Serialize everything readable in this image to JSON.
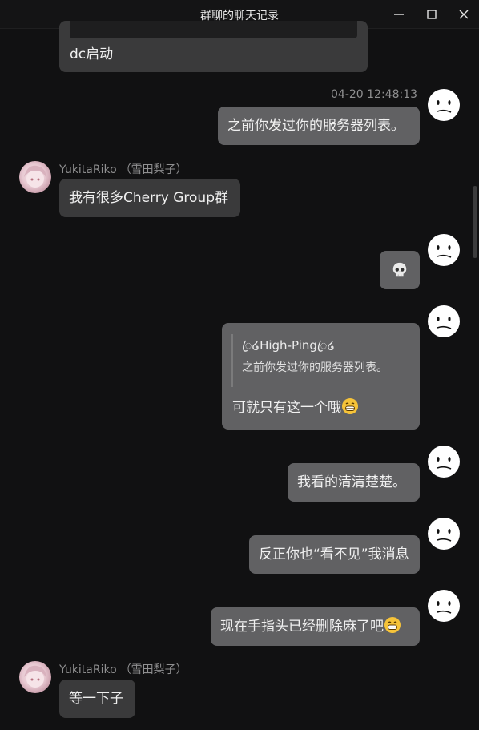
{
  "window": {
    "title": "群聊的聊天记录",
    "minimize_label": "minimize",
    "maximize_label": "maximize",
    "close_label": "close"
  },
  "messages": [
    {
      "from": "other",
      "text": "dc启动"
    },
    {
      "from": "self",
      "timestamp": "04-20 12:48:13",
      "text": "之前你发过你的服务器列表。"
    },
    {
      "from": "other",
      "sender": "YukitaRiko",
      "sender_alias": "（雪田梨子）",
      "text": "我有很多Cherry Group群"
    },
    {
      "from": "self",
      "text": "💀"
    },
    {
      "from": "self",
      "quote": {
        "name": "ꦿ໒High-Pingꦿ໒",
        "text": "之前你发过你的服务器列表。"
      },
      "text": "可就只有这一个哦",
      "emoji": "grinning-face"
    },
    {
      "from": "self",
      "text": "我看的清清楚楚。"
    },
    {
      "from": "self",
      "text": "反正你也“看不见”我消息"
    },
    {
      "from": "self",
      "text": "现在手指头已经删除麻了吧",
      "emoji": "grinning-face"
    },
    {
      "from": "other",
      "sender": "YukitaRiko",
      "sender_alias": "（雪田梨子）",
      "text": "等一下子"
    }
  ],
  "colors": {
    "background": "#111112",
    "bubble_self": "#616163",
    "bubble_other": "#3a3a3b",
    "meta_text": "#8f8f90"
  }
}
